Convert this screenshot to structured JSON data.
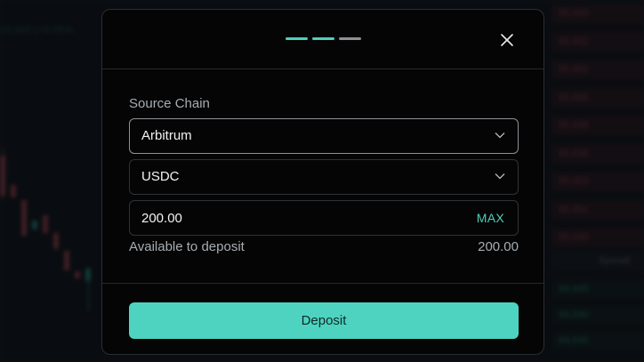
{
  "background": {
    "ticker_text": "12,000 (+0.05%",
    "orderbook_asks": [
      "95,663",
      "95,662",
      "95,661",
      "95,660",
      "95,638",
      "95,636",
      "95,653",
      "95,651",
      "95,649"
    ],
    "spread_label": "Spread",
    "orderbook_bids": [
      "94,645",
      "94,640",
      "94,645"
    ]
  },
  "modal": {
    "steps": [
      {
        "state": "complete",
        "color": "#4fcfbd"
      },
      {
        "state": "complete",
        "color": "#4fcfbd"
      },
      {
        "state": "pending",
        "color": "#8d9298"
      }
    ],
    "close_icon": "close-icon",
    "source_chain_label": "Source Chain",
    "chain_select": {
      "value": "Arbitrum",
      "icon": "chevron-down-icon"
    },
    "token_select": {
      "value": "USDC",
      "icon": "chevron-down-icon"
    },
    "amount": {
      "value": "200.00",
      "max_label": "MAX"
    },
    "available_label": "Available to deposit",
    "available_value": "200.00",
    "deposit_button": "Deposit"
  },
  "colors": {
    "accent": "#4fd3c1",
    "modal_bg": "#050505",
    "text_primary": "#f1f3f4",
    "text_secondary": "#a7adb3"
  }
}
